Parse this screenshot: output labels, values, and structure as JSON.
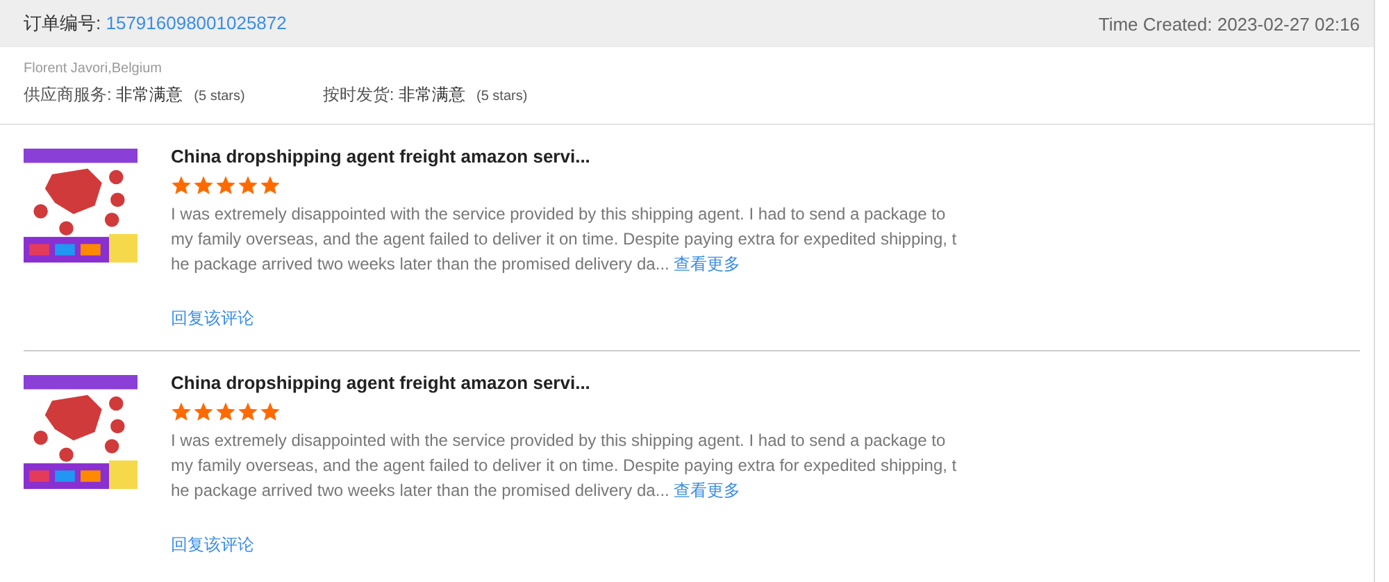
{
  "order": {
    "label": "订单编号:",
    "number": "157916098001025872",
    "time_created": "Time Created: 2023-02-27 02:16"
  },
  "buyer": "Florent Javori,Belgium",
  "ratings": [
    {
      "label": "供应商服务:",
      "value": "非常满意",
      "stars_text": "(5 stars)"
    },
    {
      "label": "按时发货:",
      "value": "非常满意",
      "stars_text": "(5 stars)"
    }
  ],
  "reviews": [
    {
      "kind": "picture",
      "title": "China dropshipping agent freight amazon servi...",
      "stars": 5,
      "text_lines": [
        "I was extremely disappointed with the service provided by this shipping agent. I had to send a package to",
        "my family overseas, and the agent failed to deliver it on time. Despite paying extra for expedited shipping, t",
        "he package arrived two weeks later than the promised delivery da..."
      ],
      "more": "查看更多",
      "reply": "回复该评论"
    },
    {
      "kind": "picture",
      "title": "China dropshipping agent freight amazon servi...",
      "stars": 5,
      "text_lines": [
        "I was extremely disappointed with the service provided by this shipping agent. I had to send a package to",
        "my family overseas, and the agent failed to deliver it on time. Despite paying extra for expedited shipping, t",
        "he package arrived two weeks later than the promised delivery da..."
      ],
      "more": "查看更多",
      "reply": "回复该评论"
    }
  ]
}
